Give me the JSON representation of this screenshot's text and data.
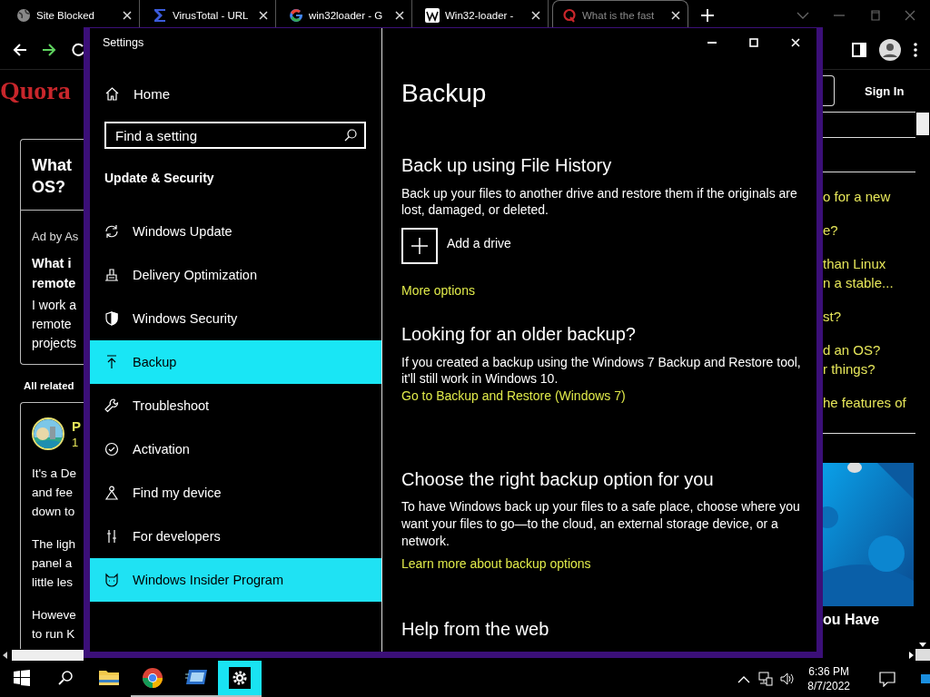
{
  "browser": {
    "tabs": [
      {
        "kind": "globe",
        "title": "Site Blocked",
        "selected": false
      },
      {
        "kind": "sigma",
        "title": "VirusTotal - URL",
        "selected": false
      },
      {
        "kind": "google",
        "title": "win32loader - G",
        "selected": false
      },
      {
        "kind": "wiki",
        "title": "Win32-loader -",
        "selected": false
      },
      {
        "kind": "quora",
        "title": "What is the fast",
        "selected": true
      }
    ],
    "page": {
      "logo": "Quora",
      "sign_in": "Sign In",
      "left": {
        "question": [
          "What",
          "OS?"
        ],
        "ad_label": "Ad by As",
        "ad_title": [
          "What i",
          "remote"
        ],
        "ad_text": [
          "I work a",
          "remote",
          "projects"
        ],
        "related": "All related",
        "author": "P",
        "author_meta": "1",
        "paragraphs": [
          [
            "It's a De",
            "and fee",
            "down to"
          ],
          [
            "The ligh",
            "panel a",
            "little les"
          ],
          [
            "Howeve",
            "to run K"
          ]
        ]
      },
      "right": {
        "links": [
          [
            "o for a new"
          ],
          [
            "e?"
          ],
          [
            "than Linux",
            "n a stable..."
          ],
          [
            "st?"
          ],
          [
            "d an OS?",
            "r things?"
          ],
          [
            "he features of"
          ]
        ],
        "caption": "ou Have"
      }
    }
  },
  "settings": {
    "title": "Settings",
    "home": "Home",
    "search_placeholder": "Find a setting",
    "section": "Update & Security",
    "nav": [
      {
        "kind": "update",
        "label": "Windows Update",
        "selected": false,
        "hovered": false
      },
      {
        "kind": "delivery",
        "label": "Delivery Optimization",
        "selected": false,
        "hovered": false
      },
      {
        "kind": "security",
        "label": "Windows Security",
        "selected": false,
        "hovered": false
      },
      {
        "kind": "backup",
        "label": "Backup",
        "selected": true,
        "hovered": false
      },
      {
        "kind": "troubleshoot",
        "label": "Troubleshoot",
        "selected": false,
        "hovered": false
      },
      {
        "kind": "activation",
        "label": "Activation",
        "selected": false,
        "hovered": false
      },
      {
        "kind": "find",
        "label": "Find my device",
        "selected": false,
        "hovered": false
      },
      {
        "kind": "developers",
        "label": "For developers",
        "selected": false,
        "hovered": false
      },
      {
        "kind": "insider",
        "label": "Windows Insider Program",
        "selected": false,
        "hovered": true
      }
    ],
    "page": {
      "title": "Backup",
      "sections": [
        {
          "heading": "Back up using File History",
          "text": "Back up your files to another drive and restore them if the originals are lost, damaged, or deleted.",
          "add_drive": "Add a drive",
          "link": "More options"
        },
        {
          "heading": "Looking for an older backup?",
          "text": "If you created a backup using the Windows 7 Backup and Restore tool, it'll still work in Windows 10.",
          "link": "Go to Backup and Restore (Windows 7)"
        },
        {
          "heading": "Choose the right backup option for you",
          "text": "To have Windows back up your files to a safe place, choose where you want your files to go—to the cloud, an external storage device, or a network.",
          "link": "Learn more about backup options"
        },
        {
          "heading": "Help from the web"
        }
      ]
    }
  },
  "taskbar": {
    "apps": [
      {
        "kind": "explorer",
        "running": false,
        "selected": false
      },
      {
        "kind": "chrome",
        "running": true,
        "selected": false
      },
      {
        "kind": "app",
        "running": true,
        "selected": false
      },
      {
        "kind": "settings",
        "running": true,
        "selected": true
      }
    ],
    "time": "6:36 PM",
    "date": "8/7/2022"
  }
}
